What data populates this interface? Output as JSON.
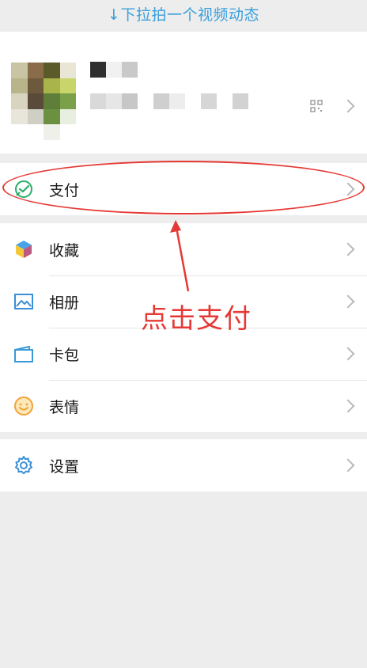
{
  "pull_hint": "↓下拉拍一个视频动态",
  "profile": {
    "avatar_colors": [
      "#c9c4a3",
      "#8a6b4a",
      "#5b5a2a",
      "#e9e6d6",
      "#b8b58a",
      "#6d5a3d",
      "#a9b54a",
      "#c8d56a",
      "#d8d4c0",
      "#5a4a3a",
      "#5e7e3a",
      "#7aa04a",
      "#e8e6da",
      "#d0cfc6",
      "#6a9040",
      "#e9efe0",
      "#ffffff",
      "#ffffff",
      "#f0f0ea",
      "#ffffff"
    ],
    "name_mosaic_colors": [
      "#2f2f2f",
      "#f1f1f1",
      "#c9c9c9"
    ],
    "id_mosaic_colors": [
      "#d9d9d9",
      "#e6e6e6",
      "#c7c7c7",
      "#ededed",
      "#cfcfcf",
      "#d6d6d6",
      "#e8e8e8",
      "#d2d2d2",
      "#e1e1e1"
    ]
  },
  "menu": {
    "pay_label": "支付",
    "favorites_label": "收藏",
    "album_label": "相册",
    "cards_label": "卡包",
    "stickers_label": "表情",
    "settings_label": "设置"
  },
  "annotation": {
    "text": "点击支付",
    "color": "#e53935"
  },
  "colors": {
    "accent_blue": "#3aa0dc",
    "wechat_green": "#2aae67",
    "background": "#ededed"
  }
}
